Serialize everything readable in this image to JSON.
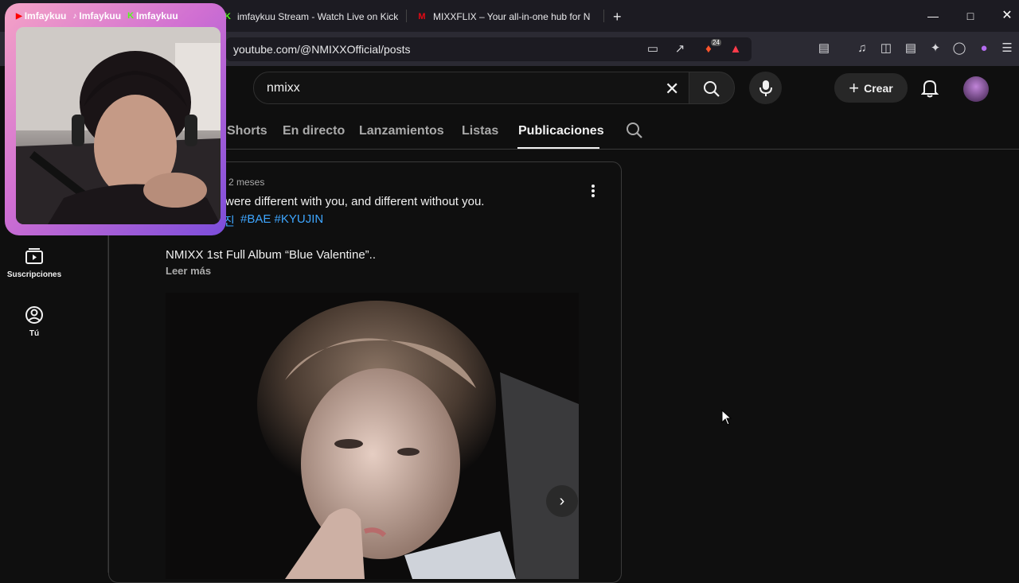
{
  "browser": {
    "tabs": [
      {
        "label": "imfaykuu Stream - Watch Live on Kick",
        "icon": "kick-icon"
      },
      {
        "label": "MIXXFLIX – Your all-in-one hub for N",
        "icon": "mixxflix-icon"
      }
    ],
    "new_tab": "+",
    "url": "youtube.com/@NMIXXOfficial/posts",
    "brave_badge": "24"
  },
  "youtube": {
    "search_value": "nmixx",
    "create_label": "Crear",
    "channel_tabs": [
      "Shorts",
      "En directo",
      "Lanzamientos",
      "Listas",
      "Publicaciones"
    ],
    "active_tab": "Publicaciones",
    "sidebar": [
      {
        "label": "Suscripciones",
        "icon": "subscriptions-icon"
      },
      {
        "label": "Tú",
        "icon": "account-icon"
      }
    ],
    "post": {
      "time": "2 meses",
      "text": "were different with you, and different without you.",
      "hashtag_prefix": "진",
      "hashtags": "#BAE #KYUJIN",
      "album": "NMIXX 1st Full Album “Blue Valentine”..",
      "read_more": "Leer más"
    }
  },
  "overlay": {
    "socials": [
      "Imfaykuu",
      "Imfaykuu",
      "Imfaykuu"
    ]
  },
  "colors": {
    "background": "#0f0f0f",
    "hashtag": "#3ea6ff",
    "tabstrip": "#1c1b22"
  }
}
